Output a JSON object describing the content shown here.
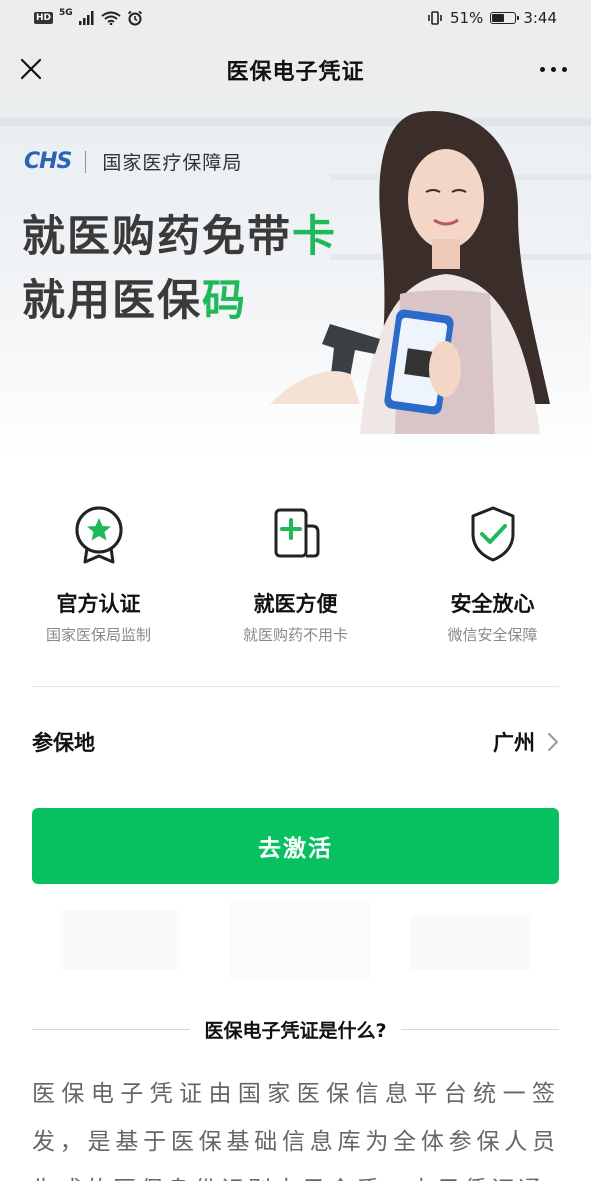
{
  "status_bar": {
    "hd_badge": "HD",
    "network": "5G",
    "battery_percent": "51%",
    "battery_level": 0.51,
    "time": "3:44",
    "icons": [
      "wifi-icon",
      "signal-icon",
      "alarm-icon",
      "vibrate-icon",
      "battery-icon"
    ]
  },
  "nav": {
    "title": "医保电子凭证",
    "close_icon": "close-icon",
    "more_icon": "more-icon"
  },
  "banner": {
    "logo_text": "CHS",
    "agency": "国家医疗保障局",
    "slogan_line1_main": "就医购药免带",
    "slogan_line1_highlight": "卡",
    "slogan_line2_main": "就用医保",
    "slogan_line2_highlight": "码",
    "highlight_color": "#1fb95a"
  },
  "features": [
    {
      "icon": "ribbon-star-icon",
      "title": "官方认证",
      "subtitle": "国家医保局监制"
    },
    {
      "icon": "medical-card-icon",
      "title": "就医方便",
      "subtitle": "就医购药不用卡"
    },
    {
      "icon": "shield-check-icon",
      "title": "安全放心",
      "subtitle": "微信安全保障"
    }
  ],
  "insured_place": {
    "label": "参保地",
    "value": "广州"
  },
  "activate_button": {
    "label": "去激活",
    "color": "#07c160"
  },
  "what_is": {
    "heading": "医保电子凭证是什么?",
    "description": "医保电子凭证由国家医保信息平台统一签发，是基于医保基础信息库为全体参保人员生成的医保身份识别电子介质，电子凭证通"
  }
}
